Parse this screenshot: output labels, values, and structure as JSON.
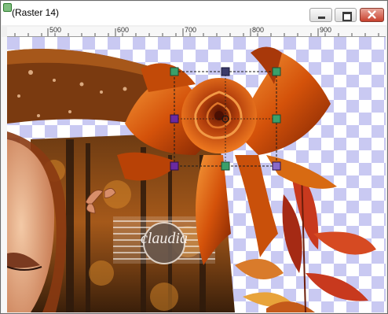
{
  "window": {
    "title": "(Raster 14)",
    "buttons": [
      "minimize",
      "maximize",
      "close"
    ]
  },
  "ruler": {
    "labels": [
      "500",
      "600",
      "700",
      "800",
      "900"
    ]
  },
  "canvas": {
    "watermark_logo": "claudia",
    "transparency_pattern": "checkerboard",
    "colors": {
      "checker_a": "#ffffff",
      "checker_b": "#c9c9f2",
      "bow_orange": "#e8660f",
      "bow_dark": "#8a2a04",
      "leaf_red": "#c8391e"
    }
  },
  "icons": {
    "app": "raster-layer-icon",
    "selection": "pick-tool-handles"
  }
}
